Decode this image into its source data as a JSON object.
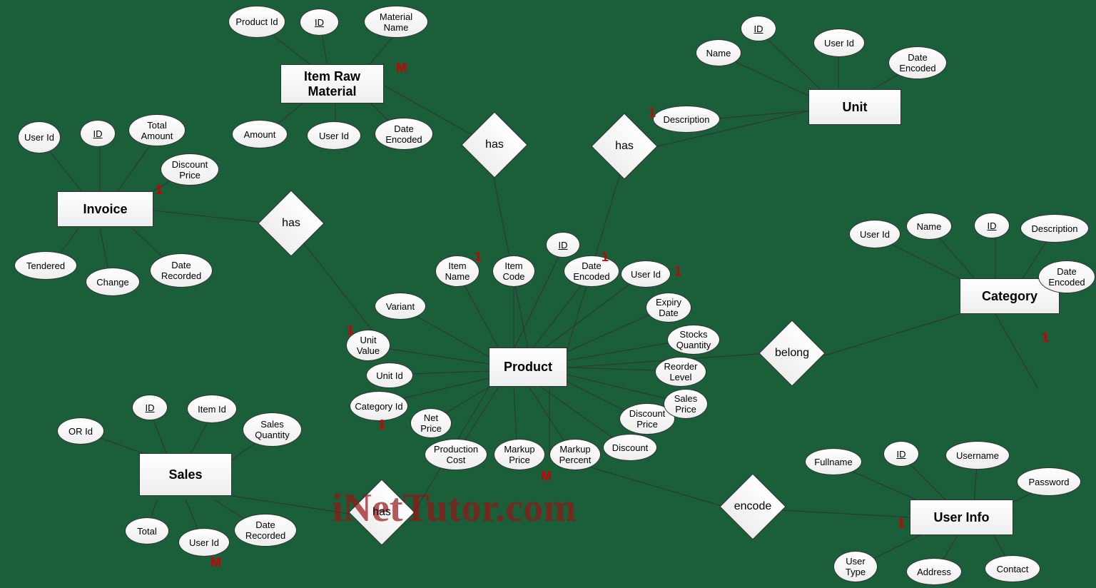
{
  "watermark": "iNetTutor.com",
  "entities": {
    "item_raw": "Item Raw Material",
    "invoice": "Invoice",
    "unit": "Unit",
    "category": "Category",
    "product": "Product",
    "sales": "Sales",
    "user_info": "User Info"
  },
  "relations": {
    "has1": "has",
    "has2": "has",
    "has3": "has",
    "has4": "has",
    "belong": "belong",
    "encode": "encode"
  },
  "attrs": {
    "irm_pid": "Product Id",
    "irm_id": "ID",
    "irm_mname": "Material Name",
    "irm_amt": "Amount",
    "irm_uid": "User Id",
    "irm_de": "Date Encoded",
    "inv_uid": "User Id",
    "inv_id": "ID",
    "inv_ta": "Total Amount",
    "inv_dp": "Discount Price",
    "inv_ten": "Tendered",
    "inv_ch": "Change",
    "inv_dr": "Date Recorded",
    "un_name": "Name",
    "un_id": "ID",
    "un_uid": "User Id",
    "un_desc": "Description",
    "un_de": "Date Encoded",
    "cat_name": "Name",
    "cat_id": "ID",
    "cat_desc": "Description",
    "cat_uid": "User Id",
    "cat_de": "Date Encoded",
    "p_id": "ID",
    "p_in": "Item Name",
    "p_ic": "Item Code",
    "p_de": "Date Encoded",
    "p_uid": "User Id",
    "p_var": "Variant",
    "p_uv": "Unit Value",
    "p_unid": "Unit Id",
    "p_cid": "Category Id",
    "p_np": "Net Price",
    "p_pc": "Production Cost",
    "p_mp": "Markup Price",
    "p_mpc": "Markup Percent",
    "p_disc": "Discount",
    "p_dpr": "Discount Price",
    "p_sp": "Sales Price",
    "p_rl": "Reorder Level",
    "p_sq": "Stocks Quantity",
    "p_ed": "Expiry Date",
    "s_id": "ID",
    "s_iid": "Item Id",
    "s_or": "OR Id",
    "s_sq": "Sales Quantity",
    "s_tot": "Total",
    "s_uid": "User Id",
    "s_dr": "Date Recorded",
    "u_fn": "Fullname",
    "u_id": "ID",
    "u_un": "Username",
    "u_pw": "Password",
    "u_ut": "User Type",
    "u_ad": "Address",
    "u_ct": "Contact"
  },
  "card": {
    "m1": "M",
    "m2": "M",
    "m3": "M",
    "o1": "1",
    "o2": "1",
    "o3": "1",
    "o4": "1",
    "o5": "1",
    "o6": "1",
    "o7": "1",
    "o8": "1",
    "o9": "1"
  }
}
